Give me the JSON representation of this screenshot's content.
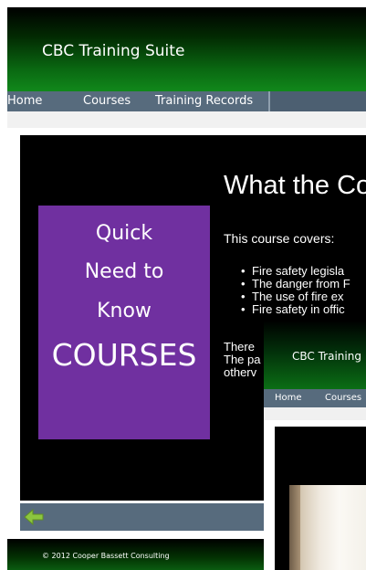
{
  "app_title": "CBC Training Suite",
  "nav": {
    "items": [
      "Home",
      "Courses",
      "Training Records"
    ]
  },
  "promo": {
    "line1": "Quick",
    "line2": "Need to",
    "line3": "Know",
    "line4": "COURSES"
  },
  "slide": {
    "heading": "What the Co",
    "covers": "This course covers:",
    "bullets": [
      "Fire safety legisla",
      "The danger from F",
      "The use of fire ex",
      "Fire safety in offic"
    ],
    "body_lines": [
      "There",
      "The pa",
      "otherv"
    ]
  },
  "footer": {
    "copyright": "© 2012 Cooper Bassett Consulting"
  },
  "overlay": {
    "app_title": "CBC Training",
    "nav": [
      "Home",
      "Courses"
    ]
  },
  "colors": {
    "nav_bg": "#576b7d",
    "promo_purple": "#7030a0",
    "header_green": "#11881b",
    "back_arrow_green": "#8cc63f"
  },
  "icons": {
    "back": "back-arrow-icon"
  }
}
